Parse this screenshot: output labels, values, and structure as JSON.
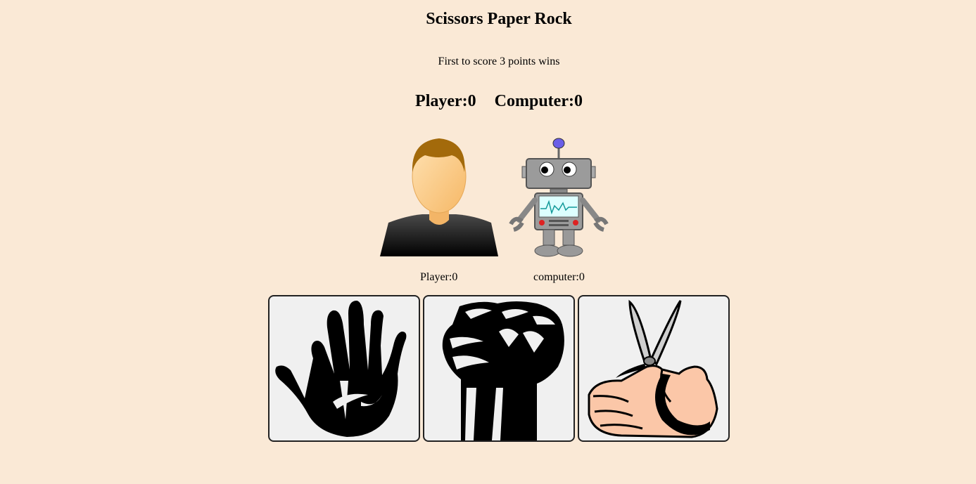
{
  "game": {
    "title": "Scissors Paper Rock",
    "rules": "First to score 3 points wins"
  },
  "scoreboard": {
    "player_label": "Player:",
    "player_score": "0",
    "computer_label": "Computer:",
    "computer_score": "0"
  },
  "small_scores": {
    "player_text": "Player:0",
    "computer_text": "computer:0"
  },
  "choices": [
    {
      "name": "paper",
      "icon": "open-hand-icon"
    },
    {
      "name": "rock",
      "icon": "fist-icon"
    },
    {
      "name": "scissors",
      "icon": "scissors-in-hand-icon"
    }
  ],
  "colors": {
    "background": "#fae9d6",
    "card_background": "#f0f0f0",
    "card_border": "#222222"
  }
}
